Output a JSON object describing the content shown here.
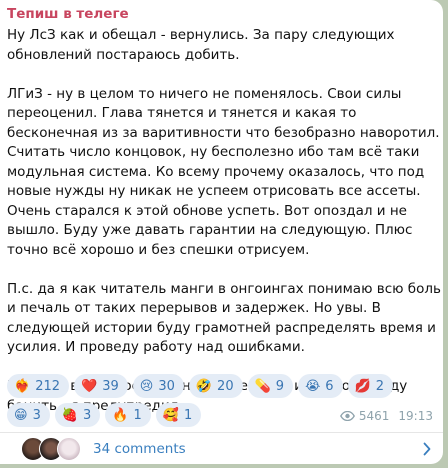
{
  "post": {
    "channel_name": "Тепиш в телеге",
    "paragraphs": [
      "Ну ЛсЗ как и обещал - вернулись. За пару следующих обновлений постараюсь добить.",
      "ЛГиЗ - ну в целом то ничего не поменялось. Свои силы переоценил. Глава тянется и тянется и какая то бесконечная из за варитивности что безобразно наворотил. Считать число концовок, ну бесполезно ибо там всё таки модульная система. Ко всему прочему оказалось, что под новые нужды ну никак не успеем отрисовать все ассеты. Очень старался к этой обнове успеть. Вот опоздал и не вышло. Буду уже давать гарантии на следующую. Плюс точно всё хорошо и без спешки отрисуем.",
      "П.с. да я как читатель манги в онгоингах понимаю всю боль и печаль от таких перерывов и задержек. Но увы. В следующей истории буду грамотней распределять время и усилия. И проведу работу над ошибками.",
      "П.п.с. за всякие остроумные замечания и подколы буду банить - я предупредил."
    ],
    "reactions": [
      {
        "emoji": "❤️‍🔥",
        "count": "212"
      },
      {
        "emoji": "❤️",
        "count": "39"
      },
      {
        "emoji": "😢",
        "count": "30"
      },
      {
        "emoji": "🤣",
        "count": "20"
      },
      {
        "emoji": "💊",
        "count": "9"
      },
      {
        "emoji": "😭",
        "count": "6"
      },
      {
        "emoji": "💋",
        "count": "2"
      },
      {
        "emoji": "😁",
        "count": "3"
      },
      {
        "emoji": "🍓",
        "count": "3"
      },
      {
        "emoji": "🔥",
        "count": "1"
      },
      {
        "emoji": "🥰",
        "count": "1"
      }
    ],
    "views": "5461",
    "time": "19:13",
    "comments_label": "34 comments"
  },
  "colors": {
    "channel_name": "#c8455f",
    "reaction_bg": "#e4ecf6",
    "reaction_text": "#3a76b3",
    "link": "#3a7fbf",
    "meta": "#8fa3ac",
    "chat_background": "#bcc9b3"
  },
  "icons": {
    "views": "eye-icon",
    "comments_chevron": "chevron-right-icon"
  }
}
